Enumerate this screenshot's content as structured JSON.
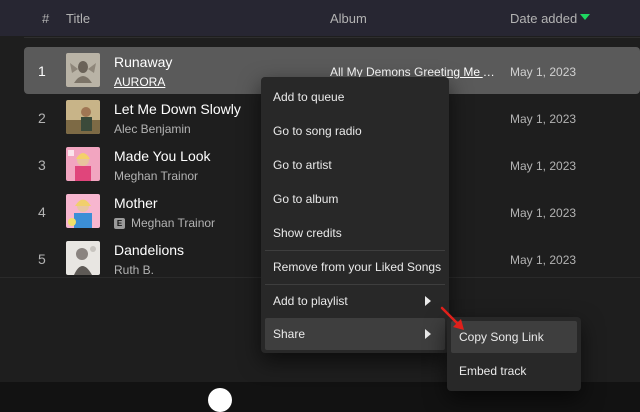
{
  "header": {
    "num_label": "#",
    "title_label": "Title",
    "album_label": "Album",
    "date_label": "Date added"
  },
  "tracks": [
    {
      "num": "1",
      "title": "Runaway",
      "artist": "AURORA",
      "album": "All My Demons Greeting Me As A Friend",
      "date": "May 1, 2023",
      "explicit": false
    },
    {
      "num": "2",
      "title": "Let Me Down Slowly",
      "artist": "Alec Benjamin",
      "album": "",
      "date": "May 1, 2023",
      "explicit": false
    },
    {
      "num": "3",
      "title": "Made You Look",
      "artist": "Meghan Trainor",
      "album": "",
      "date": "May 1, 2023",
      "explicit": false
    },
    {
      "num": "4",
      "title": "Mother",
      "artist": "Meghan Trainor",
      "album": "",
      "date": "May 1, 2023",
      "explicit": true,
      "explicit_label": "E"
    },
    {
      "num": "5",
      "title": "Dandelions",
      "artist": "Ruth B.",
      "album": "",
      "date": "May 1, 2023",
      "explicit": false
    }
  ],
  "context_menu": {
    "items": [
      {
        "label": "Add to queue"
      },
      {
        "label": "Go to song radio"
      },
      {
        "label": "Go to artist"
      },
      {
        "label": "Go to album"
      },
      {
        "label": "Show credits"
      },
      {
        "label": "Remove from your Liked Songs"
      },
      {
        "label": "Add to playlist",
        "submenu": true
      },
      {
        "label": "Share",
        "submenu": true
      }
    ]
  },
  "share_menu": {
    "items": [
      {
        "label": "Copy Song Link"
      },
      {
        "label": "Embed track"
      }
    ]
  },
  "colors": {
    "accent": "#1ed760",
    "annotation_arrow": "#e0201b",
    "selected_row": "#5a5a5a",
    "menu_bg": "#282828"
  }
}
